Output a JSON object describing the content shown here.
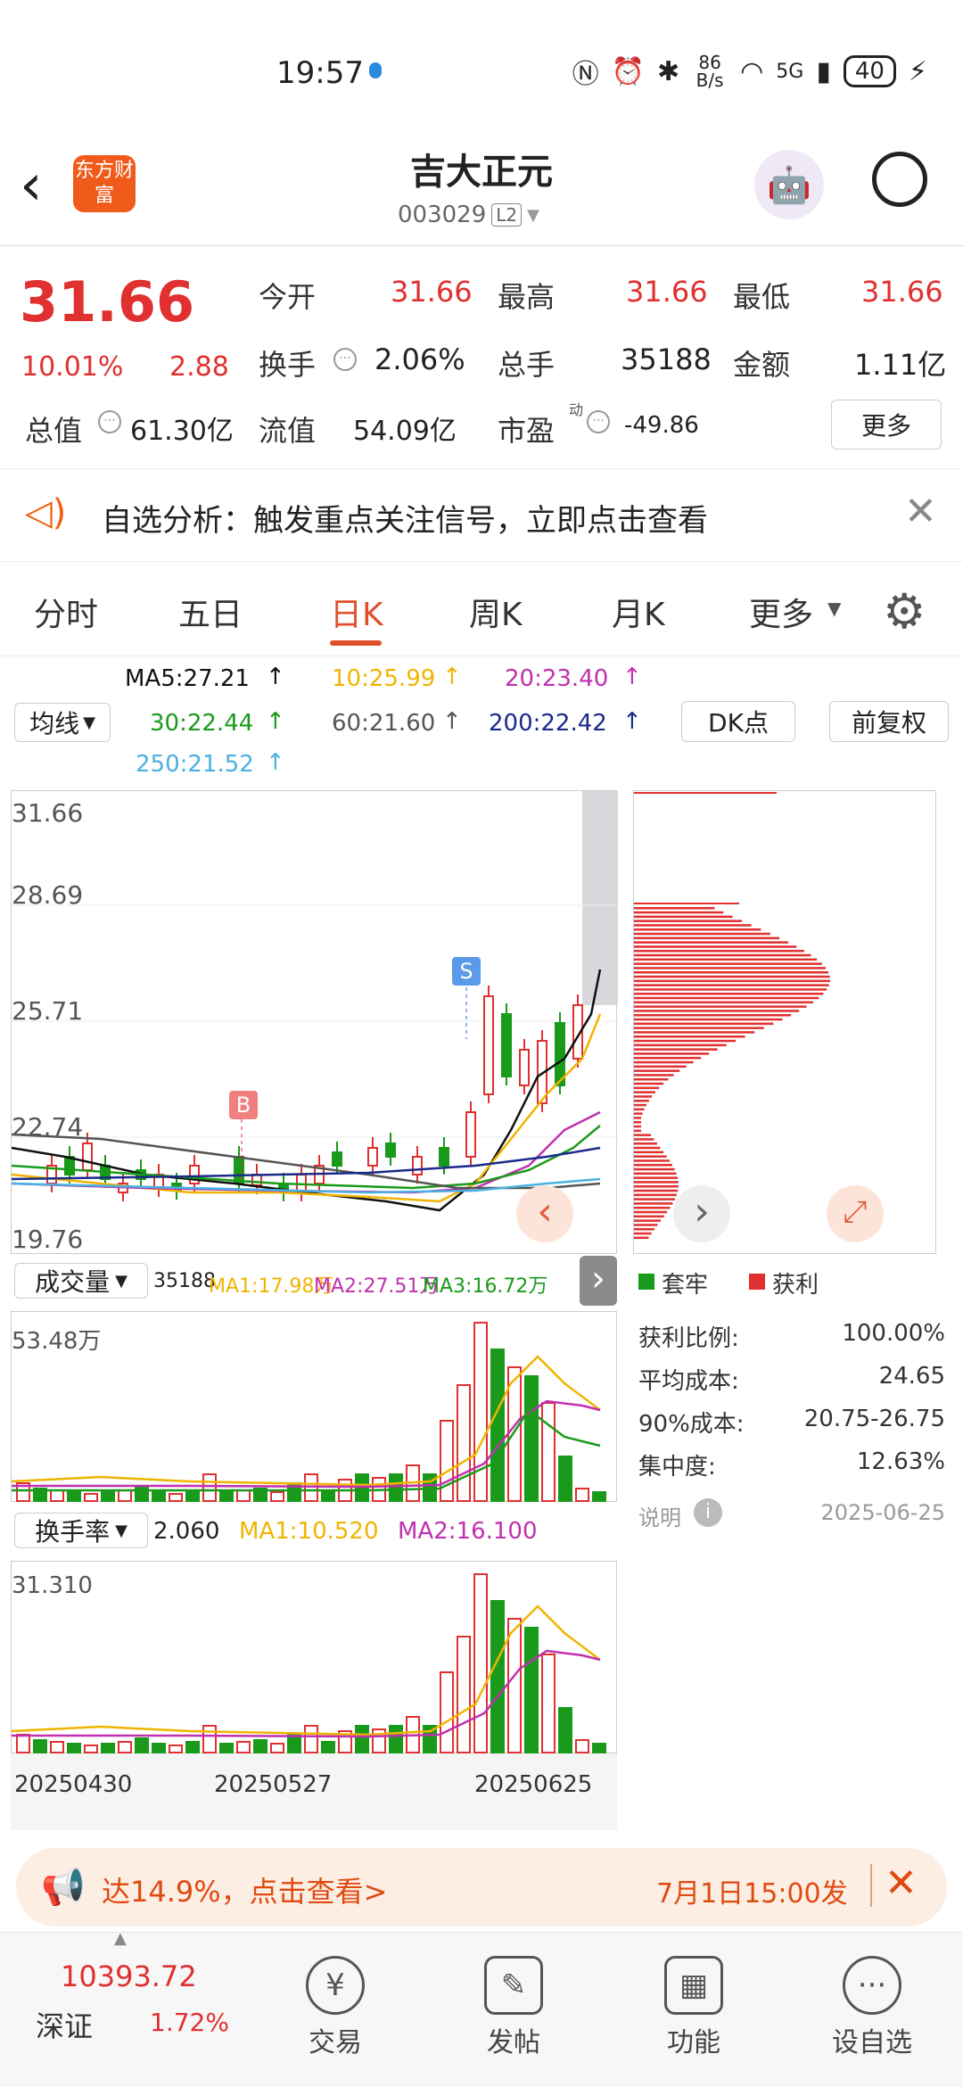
{
  "status": {
    "time": "19:57",
    "net_speed": "86 B/s",
    "signal": "5G",
    "battery": "40"
  },
  "header": {
    "brand": "东方财富",
    "stock_name": "吉大正元",
    "stock_code": "003029",
    "level": "L2"
  },
  "quote": {
    "price": "31.66",
    "change_pct": "10.01%",
    "change": "2.88",
    "open_label": "今开",
    "open": "31.66",
    "high_label": "最高",
    "high": "31.66",
    "low_label": "最低",
    "low": "31.66",
    "turnover_label": "换手",
    "turnover": "2.06%",
    "volume_label": "总手",
    "volume": "35188",
    "amount_label": "金额",
    "amount": "1.11亿",
    "mktcap_label": "总值",
    "mktcap": "61.30亿",
    "float_label": "流值",
    "float_cap": "54.09亿",
    "pe_label": "市盈",
    "pe_sup": "动",
    "pe": "-49.86",
    "more_label": "更多"
  },
  "notice": {
    "text": "自选分析：触发重点关注信号，立即点击查看"
  },
  "tabs": [
    "分时",
    "五日",
    "日K",
    "周K",
    "月K",
    "更多"
  ],
  "active_tab": "日K",
  "ma": {
    "selector": "均线",
    "ma5": "MA5:27.21",
    "ma10": "10:25.99",
    "ma20": "20:23.40",
    "ma30": "30:22.44",
    "ma60": "60:21.60",
    "ma200": "200:22.42",
    "ma250": "250:21.52",
    "dk_label": "DK点",
    "adjust_label": "前复权"
  },
  "colors": {
    "ma5": "#111111",
    "ma10": "#f0b400",
    "ma20": "#c030b0",
    "ma30": "#1a9a1a",
    "ma60": "#555555",
    "ma200": "#1a2a8a",
    "ma250": "#4ab0e0",
    "up": "#e0302f",
    "down": "#1a9a1a"
  },
  "kline": {
    "price_labels": [
      "31.66",
      "28.69",
      "25.71",
      "22.74",
      "19.76"
    ],
    "markers": {
      "buy": "B",
      "sell": "S"
    }
  },
  "chip": {
    "legend_trap": "套牢",
    "legend_profit": "获利",
    "rows": [
      {
        "label": "获利比例:",
        "value": "100.00%"
      },
      {
        "label": "平均成本:",
        "value": "24.65"
      },
      {
        "label": "90%成本:",
        "value": "20.75-26.75"
      },
      {
        "label": "集中度:",
        "value": "12.63%"
      }
    ],
    "note_label": "说明",
    "date": "2025-06-25"
  },
  "volume": {
    "selector": "成交量",
    "value": "35188",
    "ma1": "MA1:17.98万",
    "ma2": "MA2:27.51万",
    "ma3": "MA3:16.72万",
    "max_label": "53.48万"
  },
  "turnover_panel": {
    "selector": "换手率",
    "value": "2.060",
    "ma1": "MA1:10.520",
    "ma2": "MA2:16.100",
    "max_label": "31.310"
  },
  "dates": [
    "20250430",
    "20250527",
    "20250625"
  ],
  "banner": {
    "text": "达14.9%，点击查看>",
    "time_text": "7月1日15:00发"
  },
  "bottom_nav": {
    "index_value": "10393.72",
    "index_name": "深证",
    "index_change": "1.72%",
    "items": [
      "交易",
      "发帖",
      "功能",
      "设自选"
    ]
  }
}
